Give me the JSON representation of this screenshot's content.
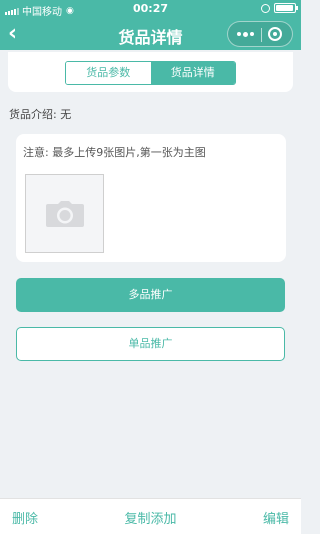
{
  "status_bar": {
    "carrier": "中国移动",
    "time": "00:27",
    "icons": [
      "signal-icon",
      "wifi-icon",
      "lock-rotation-icon",
      "battery-icon"
    ]
  },
  "nav": {
    "title": "货品详情",
    "back_icon": "chevron-left-icon",
    "capsule_icons": [
      "more-icon",
      "close-target-icon"
    ]
  },
  "tabs": [
    {
      "label": "货品参数",
      "active": false
    },
    {
      "label": "货品详情",
      "active": true
    }
  ],
  "intro": "货品介绍: 无",
  "upload": {
    "note": "注意: 最多上传9张图片,第一张为主图",
    "icon": "camera-icon"
  },
  "buttons": {
    "multi": "多品推广",
    "single": "单品推广"
  },
  "bottom_bar": {
    "delete": "删除",
    "copy_add": "复制添加",
    "edit": "编辑"
  },
  "colors": {
    "accent": "#4ab9a7",
    "background": "#eef1f4"
  }
}
